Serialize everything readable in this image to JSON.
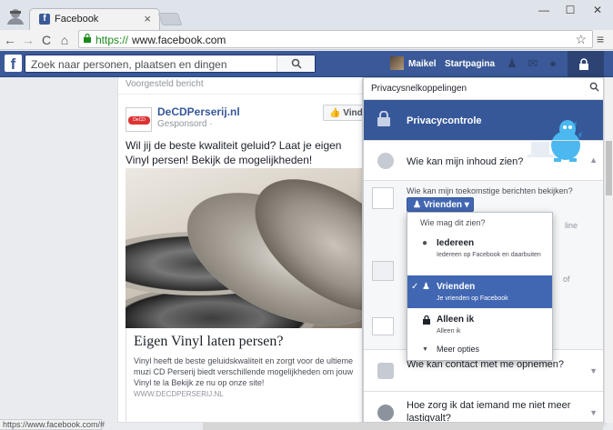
{
  "browser": {
    "tab_title": "Facebook",
    "tab_close": "×",
    "url_scheme": "https://",
    "url_host": "www.facebook.com",
    "back": "←",
    "forward": "→",
    "reload": "C",
    "home": "⌂",
    "star": "☆",
    "menu": "≡",
    "minimize": "—",
    "maximize": "☐",
    "close": "✕",
    "status_text": "https://www.facebook.com/#"
  },
  "fb": {
    "logo": "f",
    "search_placeholder": "Zoek naar personen, plaatsen en dingen",
    "user_name": "Maikel",
    "home_label": "Startpagina"
  },
  "post": {
    "suggested_label": "Voorgesteld bericht",
    "page_name": "DeCDPerserij.nl",
    "sponsored": "Gesponsord · ",
    "like_button": "Vind de",
    "text": "Wil jij de beste kwaliteit geluid? Laat je eigen Vinyl persen! Bekijk de mogelijkheden!",
    "link_title": "Eigen Vinyl laten persen?",
    "link_desc": "Vinyl heeft de beste geluidskwaliteit en zorgt voor de ultieme muzi CD Perserij biedt verschillende mogelijkheden om jouw Vinyl te la Bekijk ze nu op onze site!",
    "link_domain": "WWW.DECDPERSERIJ.NL"
  },
  "privacy": {
    "header": "Privacysnelkoppelingen",
    "banner_title": "Privacycontrole",
    "row1_label": "Wie kan mijn inhoud zien?",
    "sub_question": "Wie kan mijn toekomstige berichten bekijken?",
    "audience_button": "Vrienden ▾",
    "peek1": "line",
    "peek2": "of",
    "row2_label": "Wie kan contact met me opnemen?",
    "row3_label": "Hoe zorg ik dat iemand me niet meer lastigvalt?"
  },
  "dropdown": {
    "header": "Wie mag dit zien?",
    "options": [
      {
        "label": "Iedereen",
        "desc": "Iedereen op Facebook en daarbuiten",
        "icon": "globe-icon",
        "selected": false
      },
      {
        "label": "Vrienden",
        "desc": "Je vrienden op Facebook",
        "icon": "friends-icon",
        "selected": true
      },
      {
        "label": "Alleen ik",
        "desc": "Alleen ik",
        "icon": "lock-icon",
        "selected": false
      }
    ],
    "more": "Meer opties",
    "check": "✓"
  },
  "colors": {
    "fb_blue": "#3b5998",
    "selected_blue": "#4267b2",
    "https_green": "#1a8a1a"
  }
}
